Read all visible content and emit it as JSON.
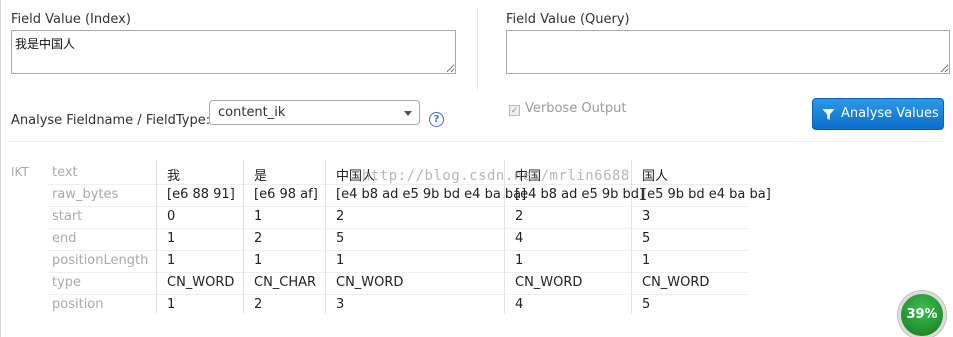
{
  "index": {
    "label": "Field Value (Index)",
    "value": "我是中国人"
  },
  "query": {
    "label": "Field Value (Query)",
    "value": ""
  },
  "fieldtype": {
    "label": "Analyse Fieldname / FieldType:",
    "selected": "content_ik",
    "help": "?"
  },
  "verbose": {
    "label": "Verbose Output",
    "checked": true
  },
  "analyse_button": {
    "label": "Analyse Values",
    "icon": "filter-icon"
  },
  "tokenizer": {
    "name": "IKT",
    "attributes": [
      "text",
      "raw_bytes",
      "start",
      "end",
      "positionLength",
      "type",
      "position"
    ],
    "tokens": [
      {
        "text": "我",
        "raw_bytes": "[e6 88 91]",
        "start": "0",
        "end": "1",
        "positionLength": "1",
        "type": "CN_WORD",
        "position": "1"
      },
      {
        "text": "是",
        "raw_bytes": "[e6 98 af]",
        "start": "1",
        "end": "2",
        "positionLength": "1",
        "type": "CN_CHAR",
        "position": "2"
      },
      {
        "text": "中国人",
        "raw_bytes": "[e4 b8 ad e5 9b bd e4 ba ba]",
        "start": "2",
        "end": "5",
        "positionLength": "1",
        "type": "CN_WORD",
        "position": "3"
      },
      {
        "text": "中国",
        "raw_bytes": "[e4 b8 ad e5 9b bd]",
        "start": "2",
        "end": "4",
        "positionLength": "1",
        "type": "CN_WORD",
        "position": "4"
      },
      {
        "text": "国人",
        "raw_bytes": "[e5 9b bd e4 ba ba]",
        "start": "3",
        "end": "5",
        "positionLength": "1",
        "type": "CN_WORD",
        "position": "5"
      }
    ]
  },
  "watermark": "http://blog.csdn.net/mrlin6688",
  "progress": {
    "label": "39%",
    "value": 0.39
  }
}
